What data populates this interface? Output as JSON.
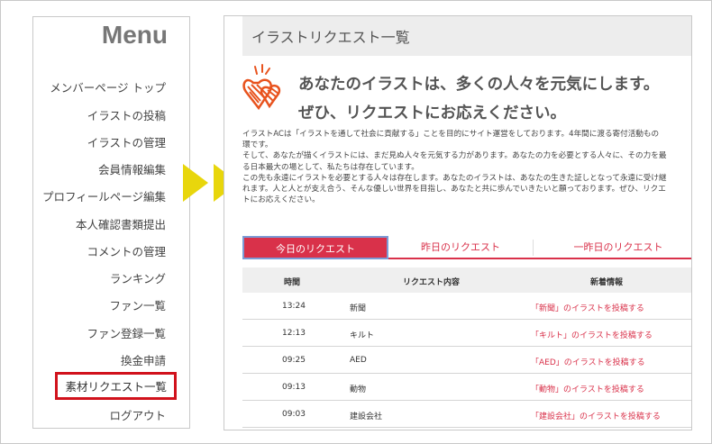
{
  "sidebar": {
    "title": "Menu",
    "items": [
      {
        "label": "メンバーページ トップ"
      },
      {
        "label": "イラストの投稿"
      },
      {
        "label": "イラストの管理"
      },
      {
        "label": "会員情報編集"
      },
      {
        "label": "プロフィールページ編集"
      },
      {
        "label": "本人確認書類提出"
      },
      {
        "label": "コメントの管理"
      },
      {
        "label": "ランキング"
      },
      {
        "label": "ファン一覧"
      },
      {
        "label": "ファン登録一覧"
      },
      {
        "label": "換金申請"
      },
      {
        "label": "素材リクエスト一覧"
      },
      {
        "label": "ログアウト"
      }
    ],
    "active_label": "素材リクエスト一覧"
  },
  "main": {
    "title": "イラストリクエスト一覧",
    "hero": {
      "line1": "あなたのイラストは、多くの人々を元気にします。",
      "line2": "ぜひ、リクエストにお応えください。"
    },
    "description": [
      "イラストACは「イラストを通して社会に貢献する」ことを目的にサイト運営をしております。4年間に渡る寄付活動もの",
      "環です。",
      "そして、あなたが描くイラストには、まだ見ぬ人々を元気する力があります。あなたの力を必要とする人々に、その力を最",
      "る日本最大の場として、私たちは存在しています。",
      "この先も永遠にイラストを必要とする人々は存在します。あなたのイラストは、あなたの生きた証しとなって永遠に受け継",
      "れます。人と人とが支え合う、そんな優しい世界を目指し、あなたと共に歩んでいきたいと願っております。ぜひ、リクエ",
      "トにお応えください。"
    ],
    "tabs": [
      {
        "label": "今日のリクエスト",
        "active": true
      },
      {
        "label": "昨日のリクエスト",
        "active": false
      },
      {
        "label": "一昨日のリクエスト",
        "active": false
      }
    ],
    "table": {
      "headers": {
        "time": "時間",
        "content": "リクエスト内容",
        "news": "新着情報"
      },
      "rows": [
        {
          "time": "13:24",
          "content": "新聞",
          "link": "「新聞」のイラストを投稿する"
        },
        {
          "time": "12:13",
          "content": "キルト",
          "link": "「キルト」のイラストを投稿する"
        },
        {
          "time": "09:25",
          "content": "AED",
          "link": "「AED」のイラストを投稿する"
        },
        {
          "time": "09:13",
          "content": "動物",
          "link": "「動物」のイラストを投稿する"
        },
        {
          "time": "09:03",
          "content": "建設会社",
          "link": "「建設会社」のイラストを投稿する"
        }
      ]
    }
  },
  "colors": {
    "accent_red": "#d9314a",
    "highlight_border": "#d1121c",
    "arrow_yellow": "#e8d60c",
    "heart_orange": "#e8531e"
  },
  "icons": {
    "hero": "hearts-icon",
    "arrows": "arrow-right-icon"
  }
}
